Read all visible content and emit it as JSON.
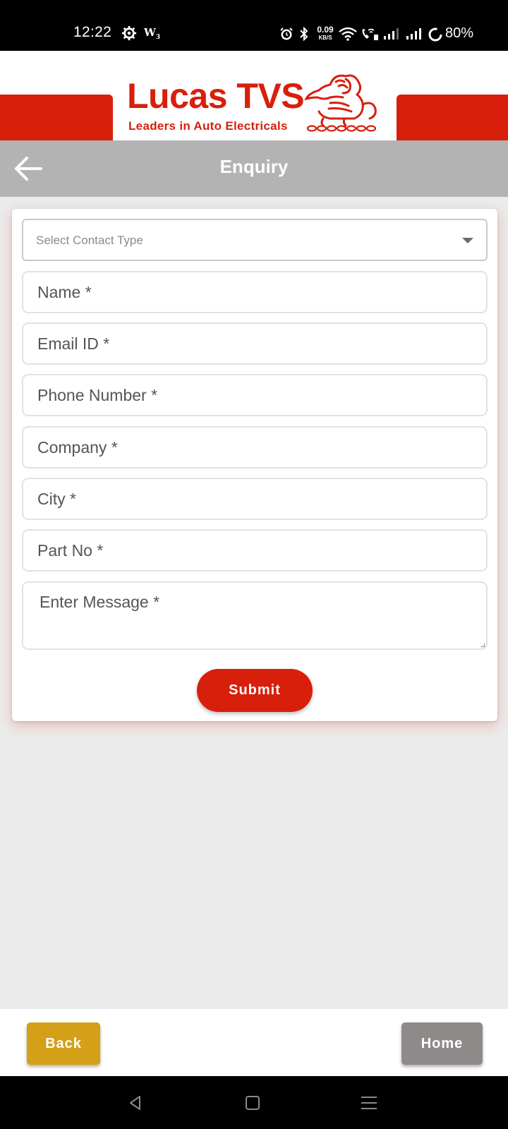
{
  "status_bar": {
    "time": "12:22",
    "network_speed_value": "0.09",
    "network_speed_unit": "KB/S",
    "battery_percent": "80%",
    "icons": [
      "settings-gear-icon",
      "w-app-icon",
      "alarm-icon",
      "bluetooth-icon",
      "wifi-icon",
      "wifi-calling-icon",
      "signal-icon",
      "signal-icon",
      "battery-ring-icon"
    ]
  },
  "header": {
    "brand_name": "Lucas TVS",
    "brand_tagline": "Leaders in Auto Electricals",
    "brand_color": "#d81f0c"
  },
  "title_bar": {
    "title": "Enquiry",
    "background": "#b3b3b3"
  },
  "form": {
    "contact_type": {
      "placeholder": "Select Contact Type"
    },
    "fields": [
      {
        "key": "name",
        "placeholder": "Name *"
      },
      {
        "key": "email",
        "placeholder": "Email ID *"
      },
      {
        "key": "phone",
        "placeholder": "Phone Number *"
      },
      {
        "key": "company",
        "placeholder": "Company *"
      },
      {
        "key": "city",
        "placeholder": "City *"
      },
      {
        "key": "part_no",
        "placeholder": "Part No *"
      }
    ],
    "message_placeholder": "Enter Message *",
    "submit_label": "Submit"
  },
  "bottom_bar": {
    "back_label": "Back",
    "home_label": "Home",
    "back_color": "#d4a017",
    "home_color": "#8e8a8a"
  }
}
